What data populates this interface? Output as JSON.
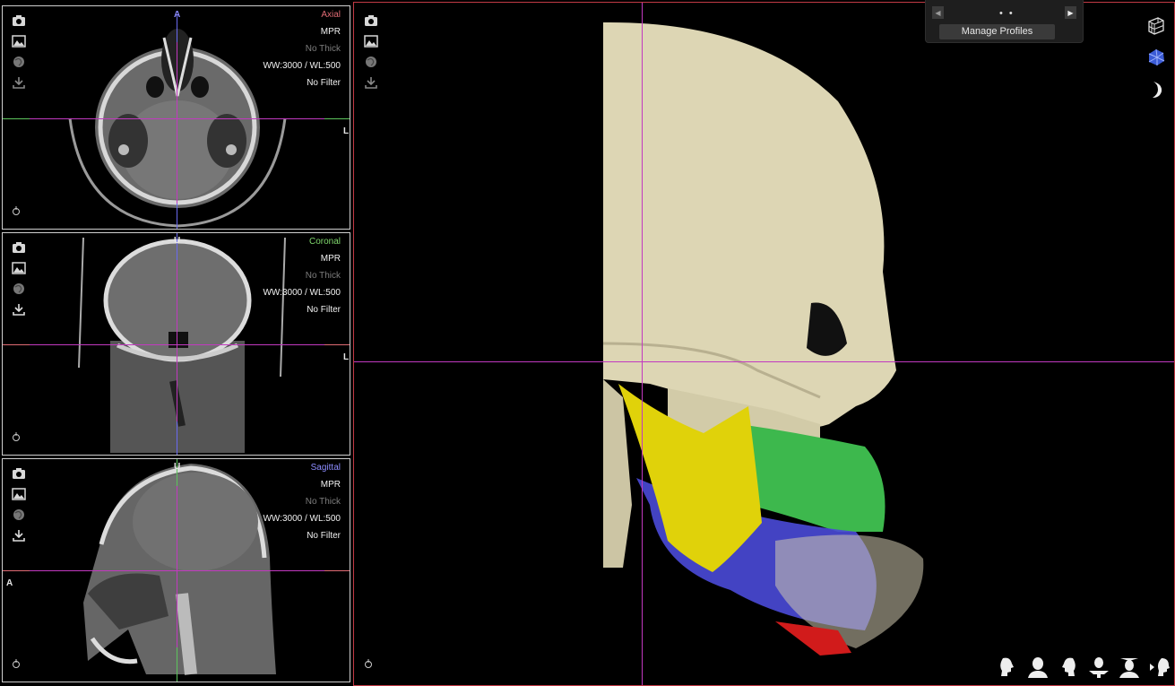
{
  "panels": [
    {
      "id": "axial",
      "name": "Axial",
      "color": "#e06b74",
      "mode": "MPR",
      "thick": "No Thick",
      "window": "WW:3000 / WL:500",
      "filter": "No Filter",
      "marker_top": "A",
      "marker_side": "L"
    },
    {
      "id": "coronal",
      "name": "Coronal",
      "color": "#7fd76c",
      "mode": "MPR",
      "thick": "No Thick",
      "window": "WW:3000 / WL:500",
      "filter": "No Filter",
      "marker_top": "U",
      "marker_side": "L"
    },
    {
      "id": "sagittal",
      "name": "Sagittal",
      "color": "#8c8cff",
      "mode": "MPR",
      "thick": "No Thick",
      "window": "WW:3000 / WL:500",
      "filter": "No Filter",
      "marker_top": "U",
      "marker_left": "A"
    }
  ],
  "profiles": {
    "manage_label": "Manage Profiles",
    "dots": "• •"
  },
  "toolbar_icons": [
    "camera-icon",
    "image-icon",
    "globe-icon",
    "download-icon"
  ],
  "right_icons": [
    "volume-grid-icon",
    "segmentation-icon",
    "crescent-icon"
  ],
  "view_presets": [
    "view-left-profile",
    "view-front",
    "view-right-profile",
    "view-bottom",
    "view-top",
    "view-rotate"
  ],
  "colors": {
    "crosshair": "#c239c0",
    "view3d_border": "#c23a45",
    "bone": "#ddd6b4",
    "segment_yellow": "#e0d20a",
    "segment_green": "#3db84d",
    "segment_blue": "#4a4ad8",
    "segment_red": "#d11b1b"
  }
}
